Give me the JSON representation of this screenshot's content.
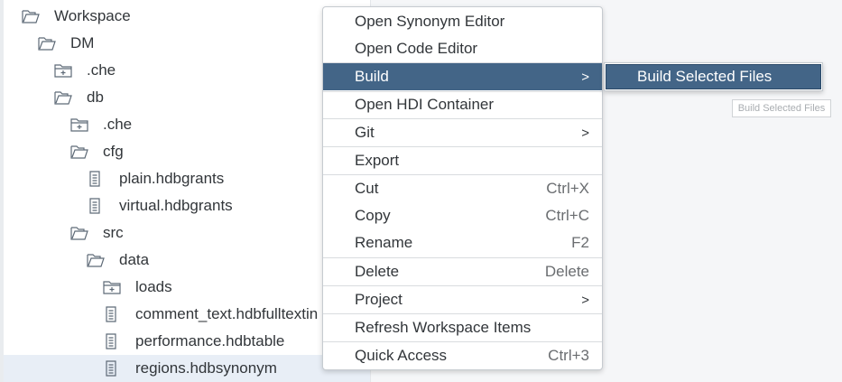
{
  "tree": {
    "items": [
      {
        "label": "Workspace",
        "icon": "folder-open-icon",
        "indent": 0
      },
      {
        "label": "DM",
        "icon": "folder-open-icon",
        "indent": 1
      },
      {
        "label": ".che",
        "icon": "folder-collapsed-icon",
        "indent": 2
      },
      {
        "label": "db",
        "icon": "folder-open-icon",
        "indent": 2
      },
      {
        "label": ".che",
        "icon": "folder-collapsed-icon",
        "indent": 3
      },
      {
        "label": "cfg",
        "icon": "folder-open-icon",
        "indent": 3
      },
      {
        "label": "plain.hdbgrants",
        "icon": "file-icon",
        "indent": 4
      },
      {
        "label": "virtual.hdbgrants",
        "icon": "file-icon",
        "indent": 4
      },
      {
        "label": "src",
        "icon": "folder-open-icon",
        "indent": 3
      },
      {
        "label": "data",
        "icon": "folder-open-icon",
        "indent": 4
      },
      {
        "label": "loads",
        "icon": "folder-collapsed-icon",
        "indent": 5
      },
      {
        "label": "comment_text.hdbfulltextin",
        "icon": "file-icon",
        "indent": 5
      },
      {
        "label": "performance.hdbtable",
        "icon": "file-icon",
        "indent": 5
      },
      {
        "label": "regions.hdbsynonym",
        "icon": "file-icon",
        "indent": 5,
        "selected": true
      }
    ]
  },
  "context_menu": {
    "items": [
      {
        "label": "Open Synonym Editor",
        "shortcut": "",
        "submenu": false
      },
      {
        "label": "Open Code Editor",
        "shortcut": "",
        "submenu": false
      },
      {
        "label": "Build",
        "shortcut": "",
        "submenu": true,
        "active": true
      },
      {
        "label": "Open HDI Container",
        "shortcut": "",
        "submenu": false
      },
      {
        "label": "Git",
        "shortcut": "",
        "submenu": true
      },
      {
        "label": "Export",
        "shortcut": "",
        "submenu": false
      },
      {
        "label": "Cut",
        "shortcut": "Ctrl+X",
        "submenu": false
      },
      {
        "label": "Copy",
        "shortcut": "Ctrl+C",
        "submenu": false
      },
      {
        "label": "Rename",
        "shortcut": "F2",
        "submenu": false
      },
      {
        "label": "Delete",
        "shortcut": "Delete",
        "submenu": false
      },
      {
        "label": "Project",
        "shortcut": "",
        "submenu": true
      },
      {
        "label": "Refresh Workspace Items",
        "shortcut": "",
        "submenu": false
      },
      {
        "label": "Quick Access",
        "shortcut": "Ctrl+3",
        "submenu": false
      }
    ],
    "submenu_arrow": ">"
  },
  "build_submenu": {
    "item_label": "Build Selected Files",
    "tooltip": "Build Selected Files"
  },
  "colors": {
    "menu_highlight": "#436587",
    "selected_row": "#e8eef6",
    "tree_icon": "#5e6a77"
  }
}
